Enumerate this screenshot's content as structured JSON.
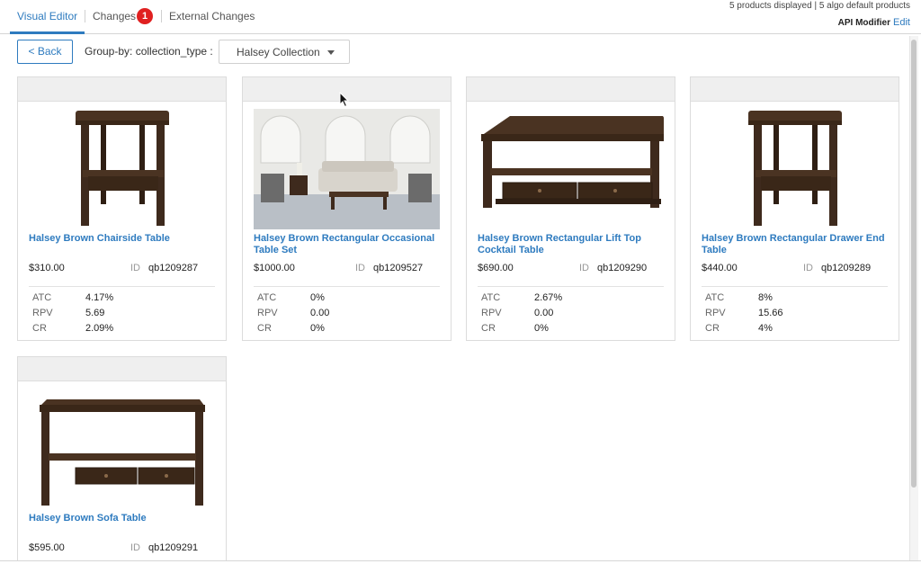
{
  "tabs": {
    "visual_editor": "Visual Editor",
    "changes": "Changes",
    "changes_count": "1",
    "external_changes": "External Changes"
  },
  "header": {
    "info": "5 products displayed | 5 algo default products",
    "api_modifier": "API Modifier",
    "edit": "Edit"
  },
  "toolbar": {
    "back_label": "< Back",
    "group_by_label": "Group-by: collection_type :",
    "selected_collection": "Halsey Collection"
  },
  "metric_labels": {
    "atc": "ATC",
    "rpv": "RPV",
    "cr": "CR"
  },
  "id_label": "ID",
  "products": [
    {
      "title": "Halsey Brown Chairside Table",
      "price": "$310.00",
      "id": "qb1209287",
      "atc": "4.17%",
      "rpv": "5.69",
      "cr": "2.09%",
      "image": "chairside-table-image"
    },
    {
      "title": "Halsey Brown Rectangular Occasional Table Set",
      "price": "$1000.00",
      "id": "qb1209527",
      "atc": "0%",
      "rpv": "0.00",
      "cr": "0%",
      "image": "living-room-set-image"
    },
    {
      "title": "Halsey Brown Rectangular Lift Top Cocktail Table",
      "price": "$690.00",
      "id": "qb1209290",
      "atc": "2.67%",
      "rpv": "0.00",
      "cr": "0%",
      "image": "cocktail-table-image"
    },
    {
      "title": "Halsey Brown Rectangular Drawer End Table",
      "price": "$440.00",
      "id": "qb1209289",
      "atc": "8%",
      "rpv": "15.66",
      "cr": "4%",
      "image": "end-table-image"
    },
    {
      "title": "Halsey Brown Sofa Table",
      "price": "$595.00",
      "id": "qb1209291",
      "image": "sofa-table-image"
    }
  ],
  "colors": {
    "accent": "#2e7bbf",
    "badge": "#e02020",
    "wood_dark": "#3e2a1d",
    "wood_mid": "#5a3d2b"
  }
}
